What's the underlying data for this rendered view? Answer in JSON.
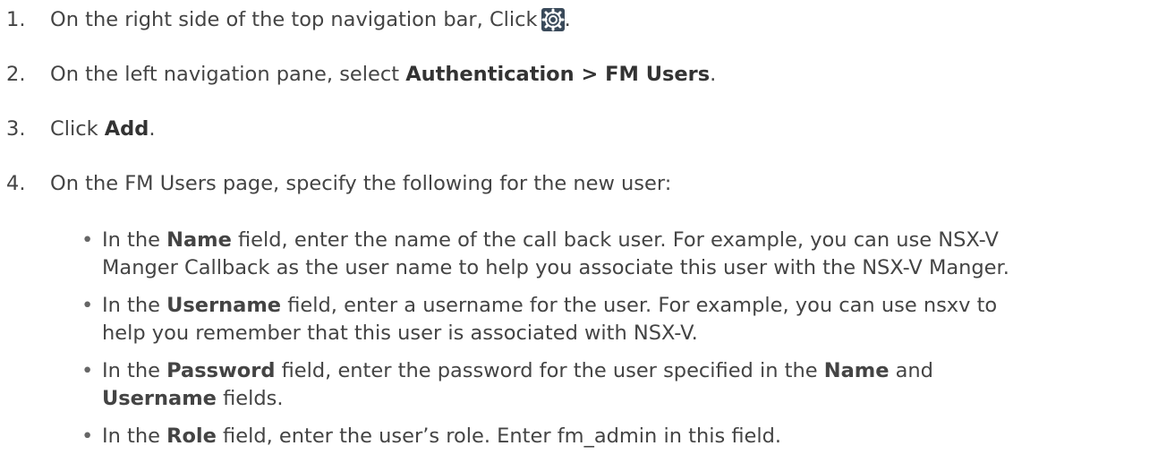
{
  "steps": [
    {
      "number": "1.",
      "text_before": "On the right side of the top navigation bar, Click",
      "text_after": "."
    },
    {
      "number": "2.",
      "text_before": "On the left navigation pane, select ",
      "bold": "Authentication > FM Users",
      "text_after": "."
    },
    {
      "number": "3.",
      "text_before": "Click ",
      "bold": "Add",
      "text_after": "."
    },
    {
      "number": "4.",
      "text": "On the FM Users page, specify the following for the new user:"
    }
  ],
  "bullets": [
    {
      "pre": "In the ",
      "bold": "Name",
      "post": " field, enter the name of the call back user. For example, you can use NSX-V",
      "cont": "Manger Callback as the user name to help you associate this user with the NSX-V Manger."
    },
    {
      "pre": "In the ",
      "bold": "Username",
      "post": " field, enter a username for the user. For example, you can use nsxv to",
      "cont": "help you remember that this user is associated with NSX-V."
    },
    {
      "pre": "In the ",
      "bold": "Password",
      "post": " field, enter the password for the user specified in the ",
      "bold2": "Name",
      "post2": " and",
      "cont_bold": "Username",
      "cont_post": " fields."
    },
    {
      "pre": "In the ",
      "bold": "Role",
      "post": " field, enter the user’s role. Enter fm_admin in this field."
    }
  ],
  "bullet_char": "•",
  "icons": {
    "settings": "gear-icon"
  },
  "colors": {
    "text": "#444444",
    "bold": "#333333",
    "icon_bg": "#3a4a5a"
  }
}
